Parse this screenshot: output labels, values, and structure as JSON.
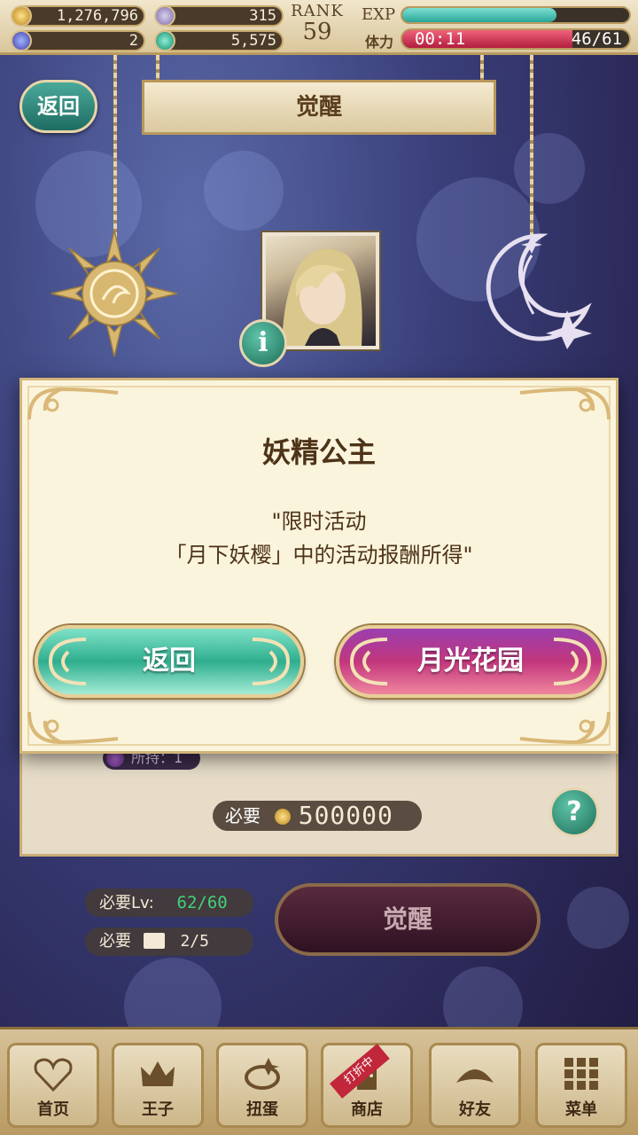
{
  "status": {
    "gold": "1,276,796",
    "feathers": "315",
    "crystals": "2",
    "gems": "5,575",
    "rank_label": "RANK",
    "rank_value": "59",
    "exp_label": "EXP",
    "exp_fraction": 0.68,
    "stamina_label": "体力",
    "stamina_timer": "00:11",
    "stamina_count": "46/61",
    "stamina_fraction": 0.75
  },
  "header": {
    "back_label": "返回",
    "title": "觉醒"
  },
  "panel": {
    "material_text": "所持：1",
    "need_label": "必要",
    "need_amount": "500000",
    "help_label": "?"
  },
  "requirements": {
    "level_label": "必要Lv:",
    "level_value": "62/60",
    "book_label": "必要",
    "book_value": "2/5"
  },
  "awaken_button": "觉醒",
  "modal": {
    "title": "妖精公主",
    "message": "\"限时活动\n「月下妖樱」中的活动报酬所得\"",
    "back_button": "返回",
    "garden_button": "月光花园"
  },
  "nav": {
    "items": [
      {
        "label": "首页",
        "icon": "heart-icon"
      },
      {
        "label": "王子",
        "icon": "crown-icon"
      },
      {
        "label": "扭蛋",
        "icon": "ring-icon"
      },
      {
        "label": "商店",
        "icon": "door-icon"
      },
      {
        "label": "好友",
        "icon": "tiara-icon"
      },
      {
        "label": "菜单",
        "icon": "grid-icon"
      }
    ],
    "shop_ribbon": "打折中"
  },
  "colors": {
    "green_button": "#2fae8e",
    "pink_button": "#c2367c",
    "modal_bg": "#fbf4dd",
    "level_ok": "#44d07a"
  }
}
